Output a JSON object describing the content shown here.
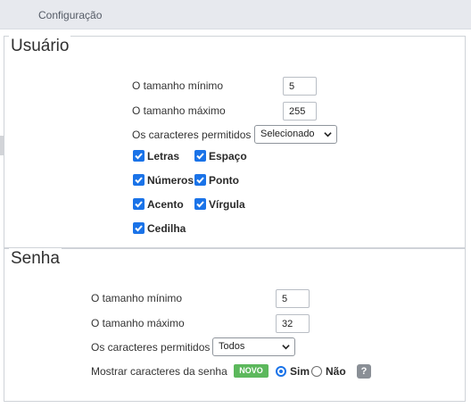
{
  "header": {
    "title": "Configuração"
  },
  "usuario": {
    "legend": "Usuário",
    "min_label": "O tamanho mínimo",
    "min_value": "5",
    "max_label": "O tamanho máximo",
    "max_value": "255",
    "chars_label": "Os caracteres permitidos",
    "chars_selected": "Selecionado",
    "options": [
      {
        "label": "Letras",
        "checked": true
      },
      {
        "label": "Espaço",
        "checked": true
      },
      {
        "label": "Números",
        "checked": true
      },
      {
        "label": "Ponto",
        "checked": true
      },
      {
        "label": "Acento",
        "checked": true
      },
      {
        "label": "Vírgula",
        "checked": true
      },
      {
        "label": "Cedilha",
        "checked": true
      }
    ]
  },
  "senha": {
    "legend": "Senha",
    "min_label": "O tamanho mínimo",
    "min_value": "5",
    "max_label": "O tamanho máximo",
    "max_value": "32",
    "chars_label": "Os caracteres permitidos",
    "chars_selected": "Todos",
    "show_label": "Mostrar caracteres da senha",
    "new_badge": "NOVO",
    "yes_label": "Sim",
    "no_label": "Não",
    "show_value": "Sim",
    "help": "?"
  },
  "colors": {
    "accent": "#1a73e8",
    "badge": "#5cb85c",
    "header_bg": "#e7e9ee"
  }
}
